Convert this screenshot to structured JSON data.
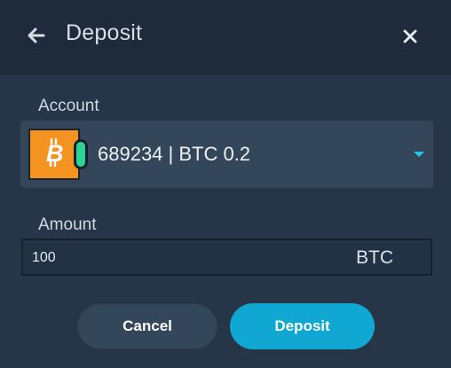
{
  "dialog": {
    "title": "Deposit",
    "back_icon": "arrow-left-icon",
    "close_icon": "close-icon"
  },
  "account": {
    "label": "Account",
    "selected_value": "689234 | BTC 0.2",
    "coin_icon": "bitcoin-icon",
    "status_color": "#2dd19a",
    "coin_color": "#f59321"
  },
  "amount": {
    "label": "Amount",
    "value": "100",
    "unit": "BTC"
  },
  "actions": {
    "cancel_label": "Cancel",
    "deposit_label": "Deposit",
    "deposit_color": "#10a8d2"
  }
}
